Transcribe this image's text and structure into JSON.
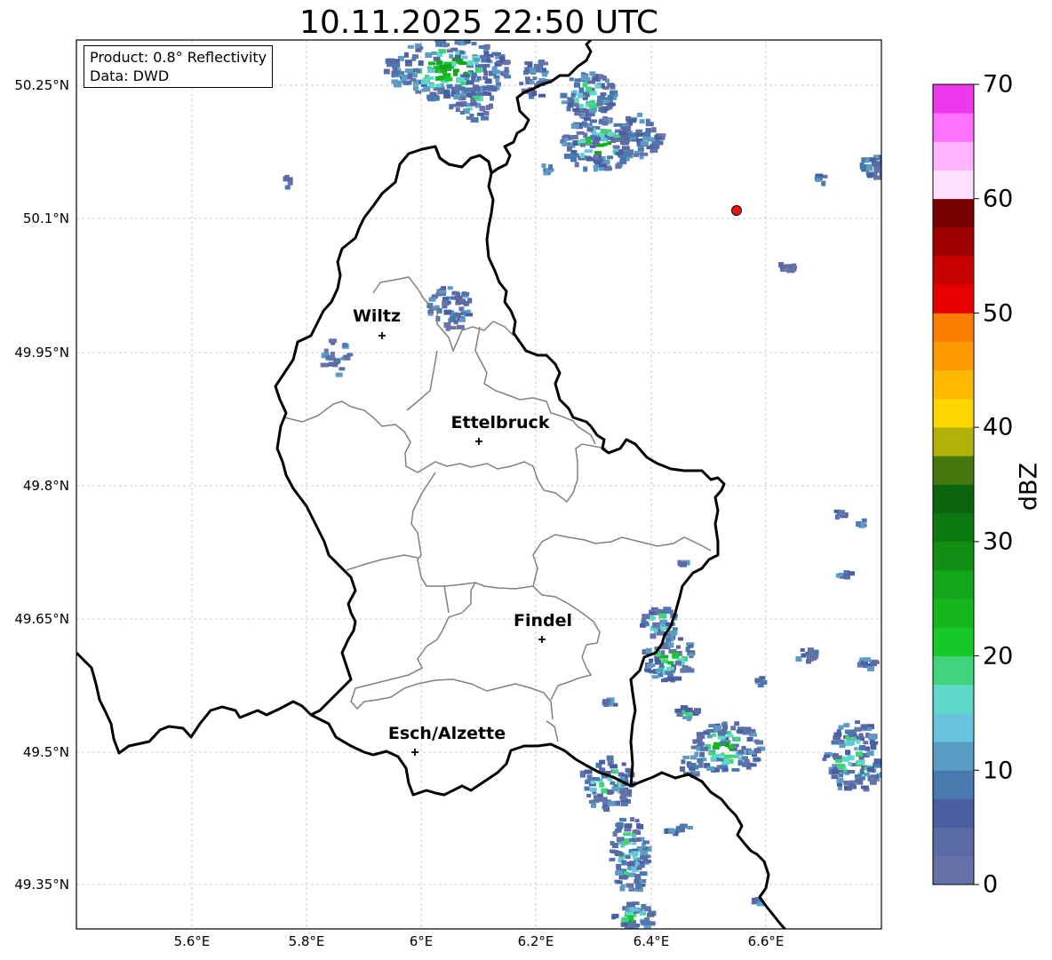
{
  "title": "10.11.2025 22:50 UTC",
  "info": {
    "product": "Product: 0.8° Reflectivity",
    "source": "Data: DWD"
  },
  "latitude_labels": [
    "50.25°N",
    "50.1°N",
    "49.95°N",
    "49.8°N",
    "49.65°N",
    "49.5°N",
    "49.35°N"
  ],
  "longitude_labels": [
    "5.6°E",
    "5.8°E",
    "6°E",
    "6.2°E",
    "6.4°E",
    "6.6°E"
  ],
  "cities": [
    {
      "name": "Wiltz"
    },
    {
      "name": "Ettelbruck"
    },
    {
      "name": "Findel"
    },
    {
      "name": "Esch/Alzette"
    }
  ],
  "colorbar": {
    "label": "dBZ",
    "ticks": [
      "0",
      "10",
      "20",
      "30",
      "40",
      "50",
      "60",
      "70"
    ],
    "min": 0,
    "max": 70,
    "step": 2.5,
    "colors": [
      "#6672a8",
      "#5a6aa5",
      "#4a5fa2",
      "#4a79b0",
      "#5b9cc4",
      "#68c4dc",
      "#5ed8c8",
      "#42d47c",
      "#16c928",
      "#14b61e",
      "#13a61a",
      "#118f14",
      "#0c7a10",
      "#0b650c",
      "#45780e",
      "#b0b20a",
      "#fdd600",
      "#fdb800",
      "#fd9a00",
      "#fd7e00",
      "#e60000",
      "#c80000",
      "#a00000",
      "#7a0000",
      "#ffdfff",
      "#ffb4ff",
      "#ff72ff",
      "#ed38ed"
    ]
  },
  "marker": {
    "color": "#ee1111"
  }
}
